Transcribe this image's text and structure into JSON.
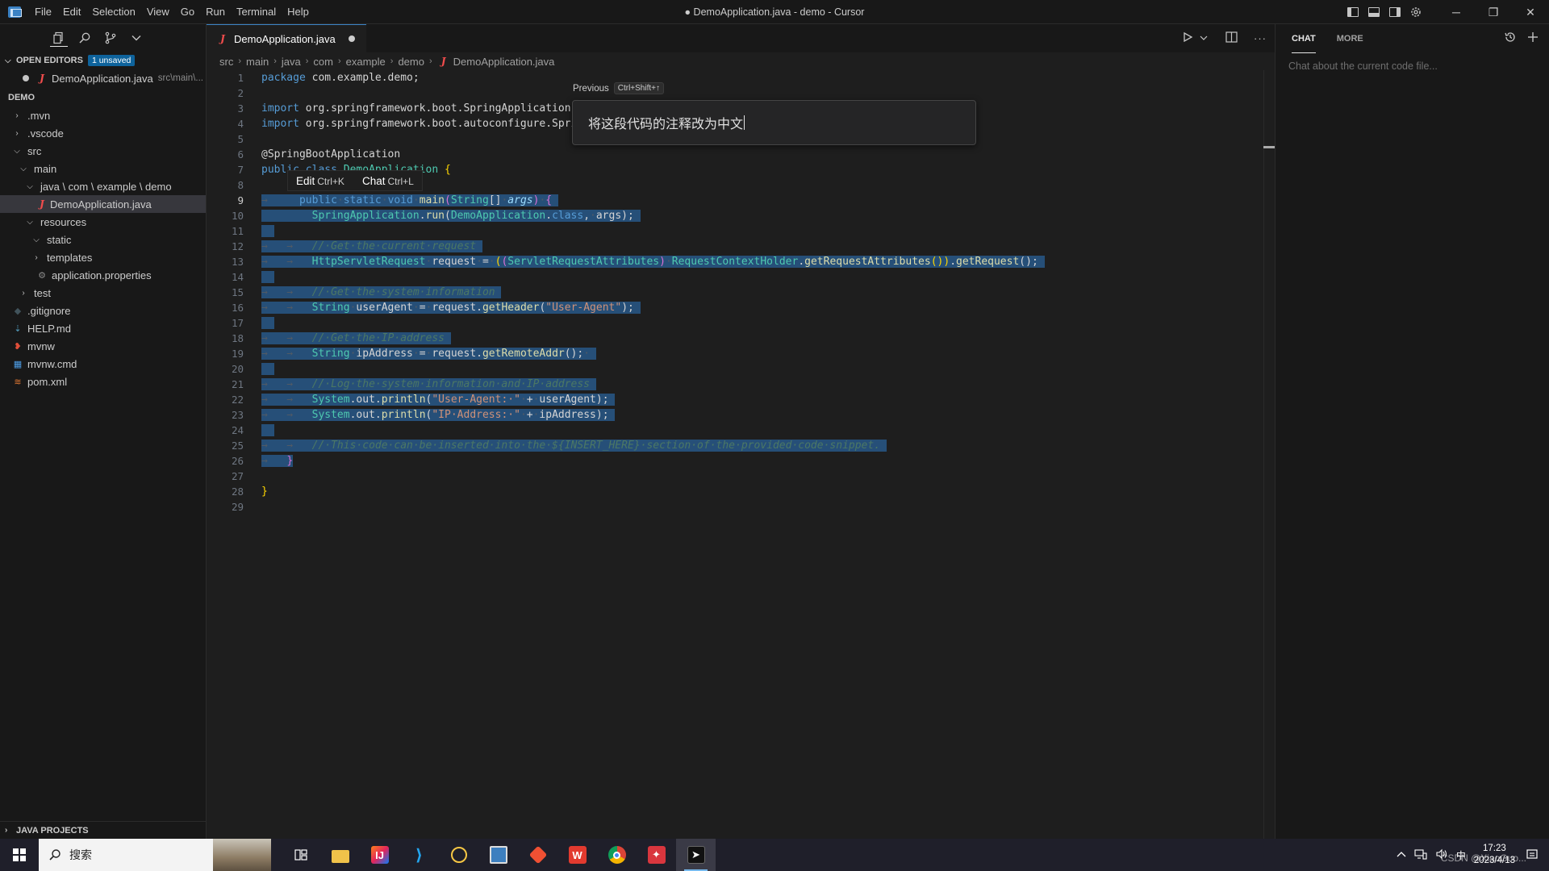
{
  "titlebar": {
    "menu": [
      "File",
      "Edit",
      "Selection",
      "View",
      "Go",
      "Run",
      "Terminal",
      "Help"
    ],
    "window_title": "● DemoApplication.java - demo - Cursor"
  },
  "explorer": {
    "open_editors_label": "OPEN EDITORS",
    "unsaved_badge": "1 unsaved",
    "open_file_name": "DemoApplication.java",
    "open_file_path": "src\\main\\...",
    "project_label": "DEMO",
    "tree": [
      {
        "label": ".mvn",
        "indent": 0,
        "kind": "folder",
        "open": false
      },
      {
        "label": ".vscode",
        "indent": 0,
        "kind": "folder",
        "open": false
      },
      {
        "label": "src",
        "indent": 0,
        "kind": "folder",
        "open": true
      },
      {
        "label": "main",
        "indent": 1,
        "kind": "folder",
        "open": true
      },
      {
        "label": "java \\ com \\ example \\ demo",
        "indent": 2,
        "kind": "folder",
        "open": true
      },
      {
        "label": "DemoApplication.java",
        "indent": 3,
        "kind": "java",
        "selected": true
      },
      {
        "label": "resources",
        "indent": 2,
        "kind": "folder",
        "open": true
      },
      {
        "label": "static",
        "indent": 3,
        "kind": "folder",
        "open": true
      },
      {
        "label": "templates",
        "indent": 3,
        "kind": "folder",
        "open": false
      },
      {
        "label": "application.properties",
        "indent": 3,
        "kind": "props"
      },
      {
        "label": "test",
        "indent": 1,
        "kind": "folder",
        "open": false
      },
      {
        "label": ".gitignore",
        "indent": 0,
        "kind": "git"
      },
      {
        "label": "HELP.md",
        "indent": 0,
        "kind": "md"
      },
      {
        "label": "mvnw",
        "indent": 0,
        "kind": "mvnw"
      },
      {
        "label": "mvnw.cmd",
        "indent": 0,
        "kind": "cmd"
      },
      {
        "label": "pom.xml",
        "indent": 0,
        "kind": "xml"
      }
    ],
    "java_projects_label": "JAVA PROJECTS"
  },
  "editor": {
    "tab_label": "DemoApplication.java",
    "breadcrumb": [
      "src",
      "main",
      "java",
      "com",
      "example",
      "demo",
      "DemoApplication.java"
    ],
    "current_line": 9,
    "line_numbers": [
      "1",
      "2",
      "3",
      "4",
      "5",
      "6",
      "7",
      "8",
      "9",
      "10",
      "11",
      "12",
      "13",
      "14",
      "15",
      "16",
      "17",
      "18",
      "19",
      "20",
      "21",
      "22",
      "23",
      "24",
      "25",
      "26",
      "27",
      "28",
      "29"
    ]
  },
  "prompt": {
    "previous_label": "Previous",
    "previous_shortcut": "Ctrl+Shift+↑",
    "input_value": "将这段代码的注释改为中文"
  },
  "hover_menu": {
    "edit_label": "Edit",
    "edit_shortcut": "Ctrl+K",
    "chat_label": "Chat",
    "chat_shortcut": "Ctrl+L"
  },
  "chat": {
    "tab_chat": "CHAT",
    "tab_more": "MORE",
    "placeholder": "Chat about the current code file..."
  },
  "taskbar": {
    "search_label": "搜索",
    "time": "17:23",
    "date": "2023/4/13",
    "ime": "中",
    "watermark": "CSDN @XiaoGuo..."
  },
  "colors": {
    "accent": "#3b82c4",
    "selection": "#264f78",
    "keyword": "#569cd6",
    "type": "#4ec9b0",
    "string": "#ce9178"
  }
}
